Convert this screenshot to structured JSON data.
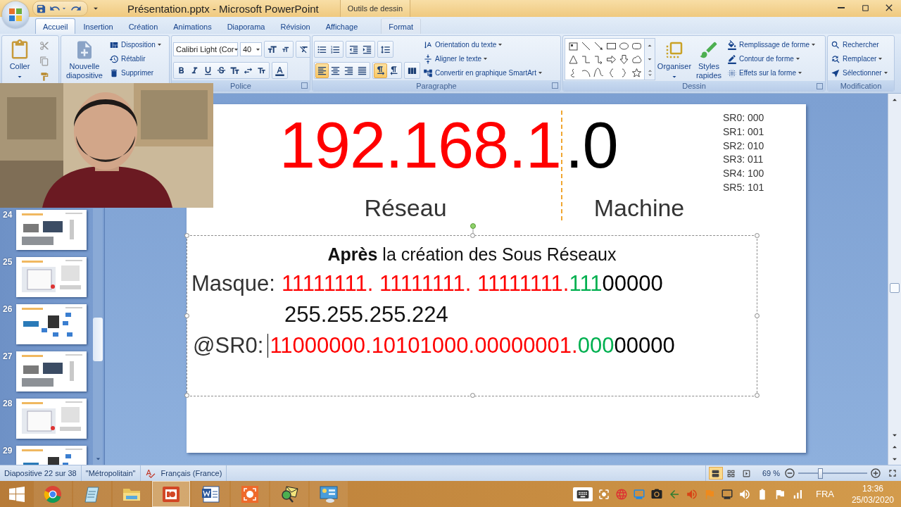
{
  "window": {
    "title": "Présentation.pptx - Microsoft PowerPoint",
    "context_group": "Outils de dessin"
  },
  "tabs": [
    {
      "label": "Accueil",
      "selected": true,
      "contextual": false
    },
    {
      "label": "Insertion",
      "selected": false,
      "contextual": false
    },
    {
      "label": "Création",
      "selected": false,
      "contextual": false
    },
    {
      "label": "Animations",
      "selected": false,
      "contextual": false
    },
    {
      "label": "Diaporama",
      "selected": false,
      "contextual": false
    },
    {
      "label": "Révision",
      "selected": false,
      "contextual": false
    },
    {
      "label": "Affichage",
      "selected": false,
      "contextual": false
    },
    {
      "label": "Format",
      "selected": false,
      "contextual": true
    }
  ],
  "ribbon": {
    "clipboard": {
      "paste": "Coller"
    },
    "slides": {
      "new_slide": "Nouvelle diapositive",
      "commands": [
        {
          "label": "Disposition",
          "kind": "layout",
          "dropdown": true
        },
        {
          "label": "Rétablir",
          "kind": "reset",
          "dropdown": false
        },
        {
          "label": "Supprimer",
          "kind": "delete",
          "dropdown": false
        }
      ]
    },
    "font": {
      "group_label": "Police",
      "name": "Calibri Light (Cor",
      "size": "40"
    },
    "paragraph": {
      "group_label": "Paragraphe",
      "alignment": [
        {
          "kind": "left",
          "selected": true
        },
        {
          "kind": "center",
          "selected": false
        },
        {
          "kind": "right",
          "selected": false
        },
        {
          "kind": "justify",
          "selected": false
        }
      ],
      "direction": [
        {
          "kind": "ltr",
          "selected": true
        },
        {
          "kind": "rtl",
          "selected": false
        }
      ],
      "commands": [
        {
          "label": "Orientation du texte",
          "kind": "orientation",
          "dropdown": true
        },
        {
          "label": "Aligner le texte",
          "kind": "align",
          "dropdown": true
        },
        {
          "label": "Convertir en graphique SmartArt",
          "kind": "smartart",
          "dropdown": true
        }
      ]
    },
    "drawing": {
      "group_label": "Dessin",
      "arrange": "Organiser",
      "quick_styles": "Styles rapides",
      "commands": [
        {
          "label": "Remplissage de forme",
          "kind": "fill",
          "dropdown": true
        },
        {
          "label": "Contour de forme",
          "kind": "outline",
          "dropdown": true
        },
        {
          "label": "Effets sur la forme",
          "kind": "effects",
          "dropdown": true
        }
      ]
    },
    "editing": {
      "group_label": "Modification",
      "commands": [
        {
          "label": "Rechercher",
          "kind": "find",
          "dropdown": false
        },
        {
          "label": "Remplacer",
          "kind": "replace",
          "dropdown": true
        },
        {
          "label": "Sélectionner",
          "kind": "select",
          "dropdown": true
        }
      ]
    }
  },
  "slides_panel": {
    "slides": [
      {
        "number": "24",
        "kind": "picture"
      },
      {
        "number": "25",
        "kind": "picture"
      },
      {
        "number": "26",
        "kind": "picture"
      },
      {
        "number": "27",
        "kind": "picture"
      },
      {
        "number": "28",
        "kind": "picture"
      },
      {
        "number": "29",
        "kind": "picture"
      }
    ]
  },
  "slide": {
    "address": {
      "network": "192.168.1",
      "host": ".0",
      "network_label": "Réseau",
      "host_label": "Machine"
    },
    "subnets": [
      "SR0: 000",
      "SR1: 001",
      "SR2: 010",
      "SR3: 011",
      "SR4: 100",
      "SR5: 101"
    ],
    "textbox": {
      "selected": true,
      "heading": "**Après** la création des Sous Réseaux",
      "mask": {
        "label": "Masque:",
        "segments": [
          {
            "text": "11111111. 11111111. 11111111.",
            "color": "#ff0000"
          },
          {
            "text": "111",
            "color": "#00b050"
          },
          {
            "text": "00000",
            "color": "#000000"
          }
        ]
      },
      "mask_decimal": "255.255.255.224",
      "subnet0": {
        "label": "@SR0:",
        "segments": [
          {
            "text": "11000000.10101000.00000001.",
            "color": "#ff0000"
          },
          {
            "text": "000",
            "color": "#00b050"
          },
          {
            "text": "00000",
            "color": "#000000"
          }
        ]
      }
    }
  },
  "status_bar": {
    "slide_info": "Diapositive 22 sur 38",
    "theme": "\"Métropolitain\"",
    "language": "Français (France)",
    "views": [
      {
        "kind": "normal",
        "selected": true
      },
      {
        "kind": "sorter",
        "selected": false
      },
      {
        "kind": "show",
        "selected": false
      }
    ],
    "zoom": "69 %",
    "zoom_slider": {
      "level": 0.32
    }
  },
  "taskbar": {
    "apps": [
      {
        "kind": "chrome",
        "active": false
      },
      {
        "kind": "notepad",
        "active": false
      },
      {
        "kind": "explorer",
        "active": false
      },
      {
        "kind": "powerpoint",
        "active": true
      },
      {
        "kind": "word",
        "active": false
      },
      {
        "kind": "recorder",
        "active": false
      },
      {
        "kind": "mail",
        "active": false
      },
      {
        "kind": "control",
        "active": false
      }
    ],
    "language": "FRA",
    "time": "13:36",
    "date": "25/03/2020"
  }
}
